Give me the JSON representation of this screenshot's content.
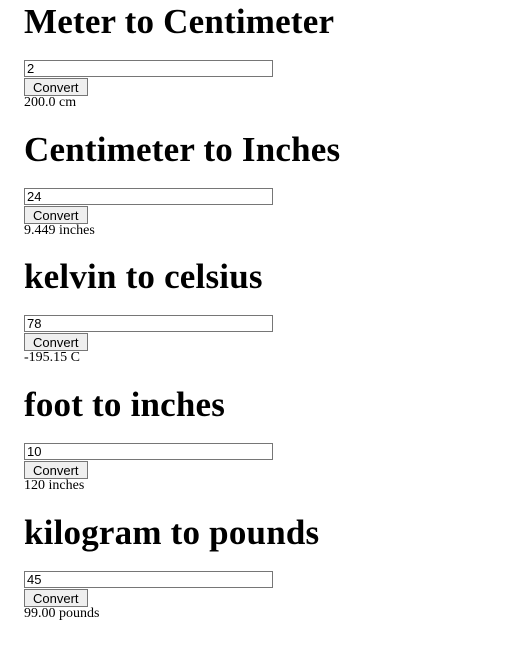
{
  "converters": [
    {
      "title": "Meter to Centimeter",
      "input_value": "2",
      "button_label": "Convert",
      "result": "200.0 cm"
    },
    {
      "title": "Centimeter to Inches",
      "input_value": "24",
      "button_label": "Convert",
      "result": "9.449 inches"
    },
    {
      "title": "kelvin to celsius",
      "input_value": "78",
      "button_label": "Convert",
      "result": "-195.15 C"
    },
    {
      "title": "foot to inches",
      "input_value": "10",
      "button_label": "Convert",
      "result": "120 inches"
    },
    {
      "title": "kilogram to pounds",
      "input_value": "45",
      "button_label": "Convert",
      "result": "99.00 pounds"
    }
  ]
}
